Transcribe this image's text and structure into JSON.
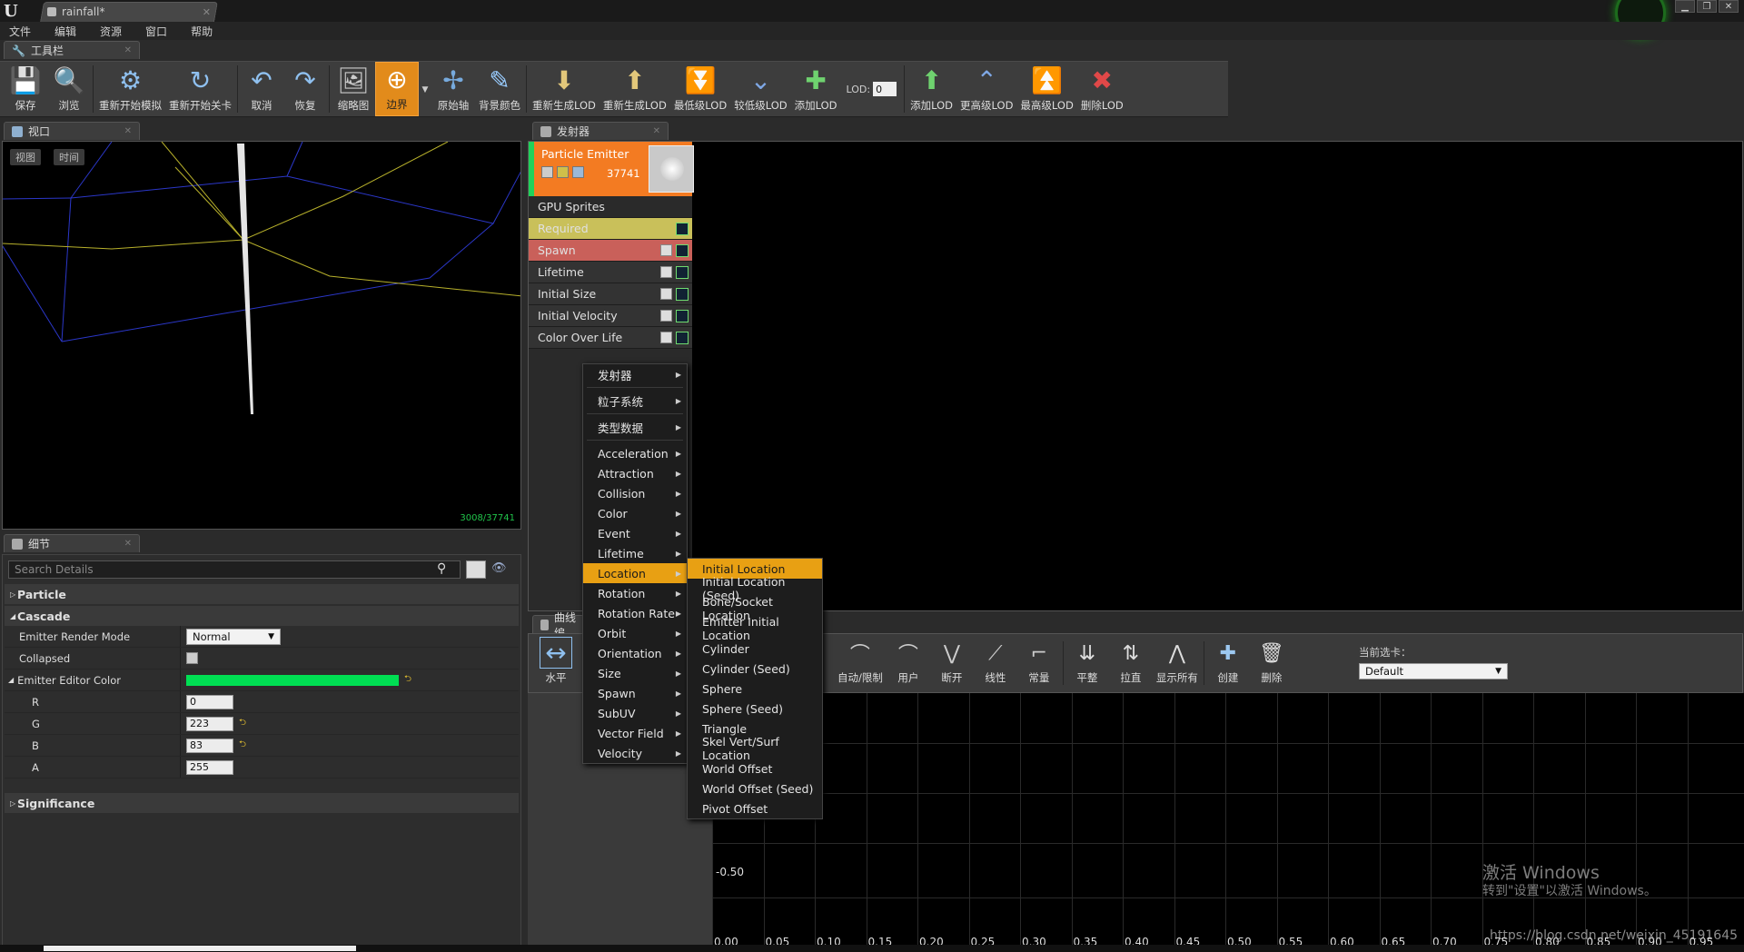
{
  "title_bar": {
    "doc_tab": "rainfall*",
    "logo": "U"
  },
  "menu": [
    "文件",
    "编辑",
    "资源",
    "窗口",
    "帮助"
  ],
  "toolbar_tab": "工具栏",
  "toolbar": {
    "items": [
      {
        "label": "保存",
        "icon": "save-icon"
      },
      {
        "label": "浏览",
        "icon": "browse-icon"
      },
      {
        "label": "重新开始模拟",
        "icon": "restart-sim-icon"
      },
      {
        "label": "重新开始关卡",
        "icon": "restart-level-icon"
      },
      {
        "label": "取消",
        "icon": "undo-icon"
      },
      {
        "label": "恢复",
        "icon": "redo-icon"
      },
      {
        "label": "缩略图",
        "icon": "thumbnail-icon"
      },
      {
        "label": "边界",
        "icon": "bounds-icon"
      },
      {
        "label": "原始轴",
        "icon": "axis-icon"
      },
      {
        "label": "背景颜色",
        "icon": "bg-color-icon"
      },
      {
        "label": "重新生成LOD",
        "icon": "regen-lod-icon"
      },
      {
        "label": "重新生成LOD",
        "icon": "regen-lod-icon"
      },
      {
        "label": "最低级LOD",
        "icon": "lowest-lod-icon"
      },
      {
        "label": "较低级LOD",
        "icon": "lower-lod-icon"
      },
      {
        "label": "添加LOD",
        "icon": "add-lod-icon"
      },
      {
        "label": "添加LOD",
        "icon": "add-lod-icon"
      },
      {
        "label": "更高级LOD",
        "icon": "higher-lod-icon"
      },
      {
        "label": "最高级LOD",
        "icon": "highest-lod-icon"
      },
      {
        "label": "删除LOD",
        "icon": "delete-lod-icon"
      }
    ],
    "lod_label": "LOD:",
    "lod_value": "0"
  },
  "viewport": {
    "tab": "视口",
    "btn_view": "视图",
    "btn_time": "时间",
    "stats": "3008/37741"
  },
  "emitter_panel": {
    "tab": "发射器",
    "emitter": {
      "title": "Particle Emitter",
      "count": "37741",
      "type": "GPU Sprites"
    },
    "modules": [
      {
        "name": "Required",
        "color": "#c9c05a"
      },
      {
        "name": "Spawn",
        "color": "#c9605a"
      },
      {
        "name": "Lifetime",
        "color": "#333333"
      },
      {
        "name": "Initial Size",
        "color": "#333333"
      },
      {
        "name": "Initial Velocity",
        "color": "#333333"
      },
      {
        "name": "Color Over Life",
        "color": "#333333"
      }
    ]
  },
  "context_menu": {
    "top": [
      "发射器",
      "粒子系统"
    ],
    "items": [
      "类型数据",
      "Acceleration",
      "Attraction",
      "Collision",
      "Color",
      "Event",
      "Lifetime",
      "Location",
      "Rotation",
      "Rotation Rate",
      "Orbit",
      "Orientation",
      "Size",
      "Spawn",
      "SubUV",
      "Vector Field",
      "Velocity"
    ],
    "selected": "Location",
    "submenu": [
      "Initial Location",
      "Initial Location (Seed)",
      "Bone/Socket Location",
      "Emitter Initial Location",
      "Cylinder",
      "Cylinder (Seed)",
      "Sphere",
      "Sphere (Seed)",
      "Triangle",
      "Skel Vert/Surf Location",
      "World Offset",
      "World Offset (Seed)",
      "Pivot Offset"
    ]
  },
  "details": {
    "tab": "细节",
    "search_placeholder": "Search Details",
    "cat_particle": "Particle",
    "cat_cascade": "Cascade",
    "cat_significance": "Significance",
    "render_mode_label": "Emitter Render Mode",
    "render_mode_value": "Normal",
    "collapsed_label": "Collapsed",
    "editor_color_label": "Emitter Editor Color",
    "editor_color": "#00df53",
    "r_label": "R",
    "r": "0",
    "g_label": "G",
    "g": "223",
    "b_label": "B",
    "b": "83",
    "a_label": "A",
    "a": "255"
  },
  "curve_editor": {
    "tab": "曲线编",
    "left_btn": "水平",
    "tools": [
      "自动/限制",
      "用户",
      "断开",
      "线性",
      "常量",
      "平整",
      "拉直",
      "显示所有",
      "创建",
      "删除"
    ],
    "current_tab_label": "当前选卡：",
    "current_tab_value": "Default",
    "y_label": "-0.50",
    "x_labels": [
      "0.00",
      "0.05",
      "0.10",
      "0.15",
      "0.20",
      "0.25",
      "0.30",
      "0.35",
      "0.40",
      "0.45",
      "0.50",
      "0.55",
      "0.60",
      "0.65",
      "0.70",
      "0.75",
      "0.80",
      "0.85",
      "0.90",
      "0.95"
    ]
  },
  "watermark": {
    "line1": "激活 Windows",
    "line2": "转到\"设置\"以激活 Windows。",
    "url": "https://blog.csdn.net/weixin_45191645"
  }
}
